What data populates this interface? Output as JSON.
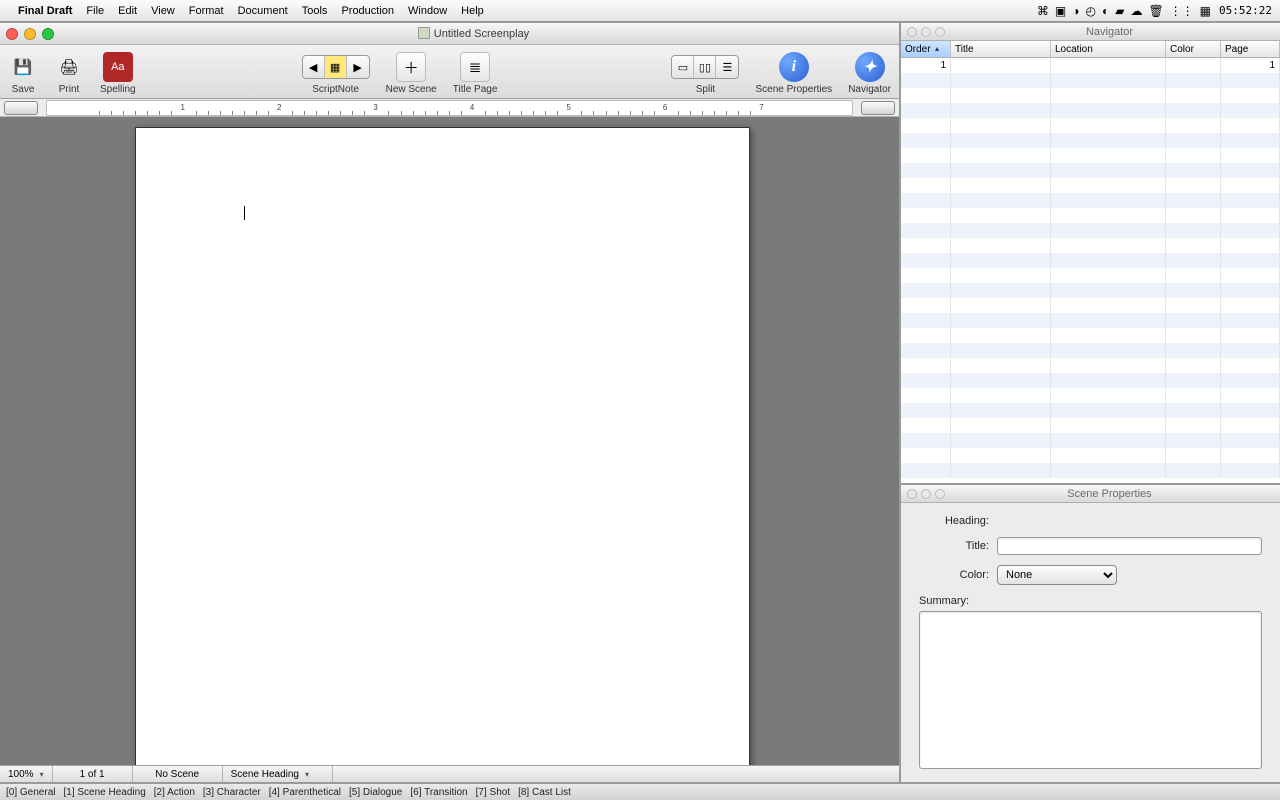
{
  "menubar": {
    "app": "Final Draft",
    "items": [
      "File",
      "Edit",
      "View",
      "Format",
      "Document",
      "Tools",
      "Production",
      "Window",
      "Help"
    ],
    "clock": "05:52:22"
  },
  "doc": {
    "title": "Untitled Screenplay",
    "toolbar": {
      "save": "Save",
      "print": "Print",
      "spelling": "Spelling",
      "scriptnote": "ScriptNote",
      "newscene": "New Scene",
      "titlepage": "Title Page",
      "split": "Split",
      "sceneprops": "Scene Properties",
      "navigator": "Navigator"
    },
    "status": {
      "zoom": "100%",
      "page": "1  of  1",
      "scene": "No Scene",
      "element": "Scene Heading"
    }
  },
  "hints": [
    "[0] General",
    "[1] Scene Heading",
    "[2] Action",
    "[3] Character",
    "[4] Parenthetical",
    "[5] Dialogue",
    "[6] Transition",
    "[7] Shot",
    "[8] Cast List"
  ],
  "ruler": {
    "nums": [
      "1",
      "2",
      "3",
      "4",
      "5",
      "6",
      "7"
    ]
  },
  "navigator": {
    "title": "Navigator",
    "cols": {
      "order": "Order",
      "title": "Title",
      "location": "Location",
      "color": "Color",
      "page": "Page"
    },
    "rows": [
      {
        "order": "1",
        "title": "",
        "location": "",
        "color": "",
        "page": "1"
      }
    ]
  },
  "props": {
    "title": "Scene Properties",
    "labels": {
      "heading": "Heading:",
      "title": "Title:",
      "color": "Color:",
      "summary": "Summary:"
    },
    "color_value": "None"
  }
}
